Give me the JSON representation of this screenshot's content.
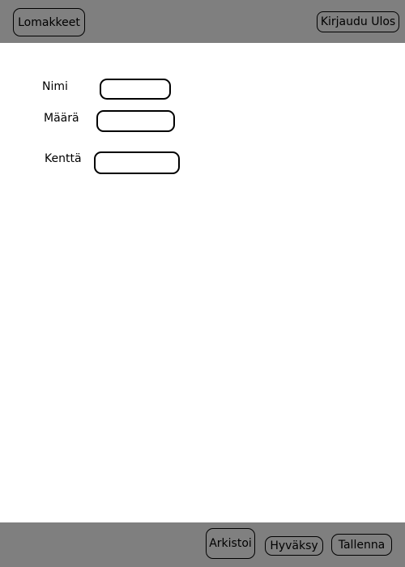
{
  "header": {
    "forms_button_label": "Lomakkeet",
    "logout_button_label": "Kirjaudu Ulos"
  },
  "form": {
    "fields": [
      {
        "label": "Nimi",
        "value": ""
      },
      {
        "label": "Määrä",
        "value": ""
      },
      {
        "label": "Kenttä",
        "value": ""
      }
    ]
  },
  "footer": {
    "archive_button_label": "Arkistoi",
    "approve_button_label": "Hyväksy",
    "save_button_label": "Tallenna"
  },
  "colors": {
    "bar_background": "#7f7f7f",
    "page_background": "#ffffff"
  }
}
